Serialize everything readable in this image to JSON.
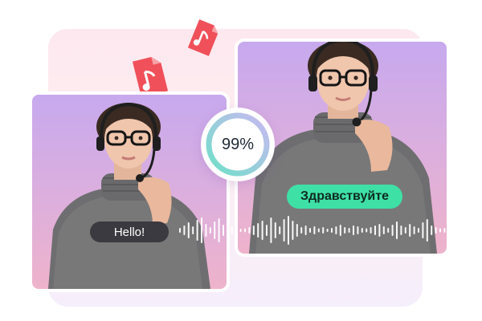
{
  "progress": {
    "percent_label": "99%",
    "value": 0.99
  },
  "captions": {
    "source_text": "Hello!",
    "translated_text": "Здравствуйте"
  },
  "icons": {
    "file_primary": "music-file-icon",
    "file_secondary": "music-file-icon"
  },
  "colors": {
    "accent_green": "#3fe0a6",
    "caption_dark": "#3a3a40",
    "progress_ring": "#5fd6c0",
    "file_red": "#f0505a"
  }
}
